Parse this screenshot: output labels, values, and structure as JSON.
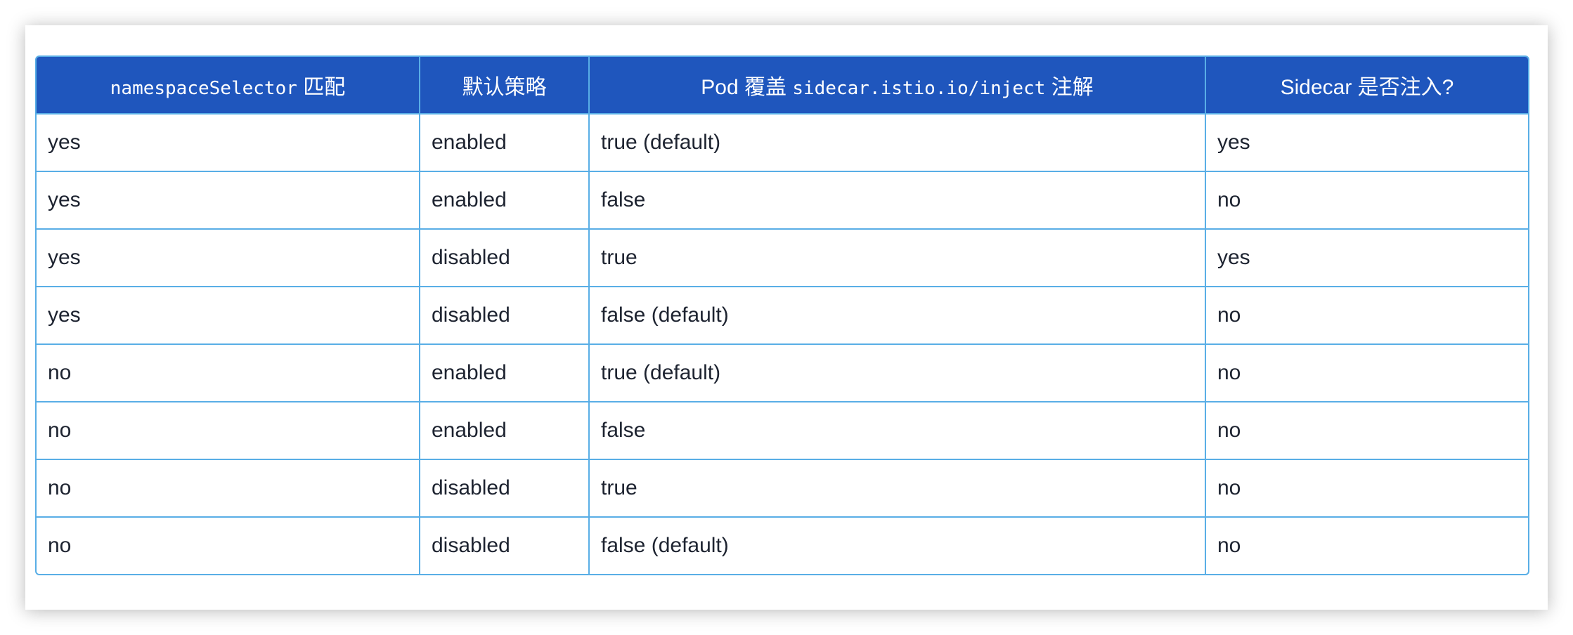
{
  "table": {
    "headers": [
      {
        "parts": [
          {
            "text": "namespaceSelector",
            "mono": true
          },
          {
            "text": " 匹配",
            "mono": false
          }
        ]
      },
      {
        "parts": [
          {
            "text": "默认策略",
            "mono": false
          }
        ]
      },
      {
        "parts": [
          {
            "text": "Pod 覆盖 ",
            "mono": false
          },
          {
            "text": "sidecar.istio.io/inject",
            "mono": true
          },
          {
            "text": " 注解",
            "mono": false
          }
        ]
      },
      {
        "parts": [
          {
            "text": "Sidecar 是否注入?",
            "mono": false
          }
        ]
      }
    ],
    "rows": [
      [
        "yes",
        "enabled",
        "true (default)",
        "yes"
      ],
      [
        "yes",
        "enabled",
        "false",
        "no"
      ],
      [
        "yes",
        "disabled",
        "true",
        "yes"
      ],
      [
        "yes",
        "disabled",
        "false (default)",
        "no"
      ],
      [
        "no",
        "enabled",
        "true (default)",
        "no"
      ],
      [
        "no",
        "enabled",
        "false",
        "no"
      ],
      [
        "no",
        "disabled",
        "true",
        "no"
      ],
      [
        "no",
        "disabled",
        "false (default)",
        "no"
      ]
    ]
  }
}
